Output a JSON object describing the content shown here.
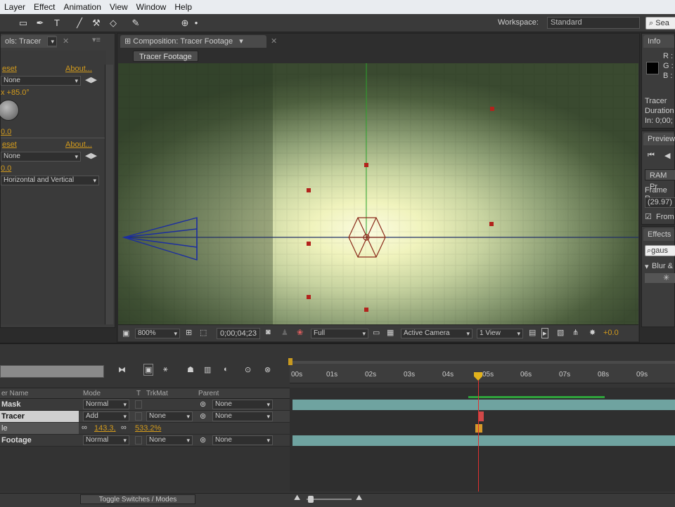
{
  "menu": [
    "Layer",
    "Effect",
    "Animation",
    "View",
    "Window",
    "Help"
  ],
  "workspace": {
    "label": "Workspace:",
    "value": "Standard"
  },
  "search": {
    "placeholder": "Sea"
  },
  "tools_panel": {
    "tab": "ols: Tracer",
    "reset1": "eset",
    "about1": "About...",
    "dd1": "None",
    "angle": "x +85.0°",
    "val1": "0.0",
    "reset2": "eset",
    "about2": "About...",
    "dd2": "None",
    "val2": "0.0",
    "dd3": "Horizontal and Vertical"
  },
  "composition": {
    "tab": "Composition: Tracer Footage",
    "subtab": "Tracer Footage"
  },
  "viewer_bar": {
    "zoom": "800%",
    "timecode": "0;00;04;23",
    "resolution": "Full",
    "camera": "Active Camera",
    "views": "1 View",
    "exposure": "+0.0"
  },
  "info_panel": {
    "tab": "Info",
    "r": "R :",
    "g": "G :",
    "b": "B :",
    "name": "Tracer",
    "duration": "Duration",
    "in": "In: 0;00;"
  },
  "preview_panel": {
    "tab": "Preview",
    "ram": "RAM Pr",
    "frame_rate": "Frame R",
    "fps": "(29.97)",
    "from": "From"
  },
  "effects_panel": {
    "tab": "Effects",
    "search": "gaus",
    "blur": "Blur &"
  },
  "timeline": {
    "headers": {
      "name": "er Name",
      "mode": "Mode",
      "t": "T",
      "trkmat": "TrkMat",
      "parent": "Parent"
    },
    "ruler": [
      "00s",
      "01s",
      "02s",
      "03s",
      "04s",
      "05s",
      "06s",
      "07s",
      "08s",
      "09s"
    ],
    "layers": [
      {
        "name": "Mask",
        "mode": "Normal",
        "trkmat": "",
        "parent": "None"
      },
      {
        "name": "Tracer",
        "mode": "Add",
        "trkmat": "None",
        "parent": "None"
      },
      {
        "name": "le",
        "mode": "",
        "trkmat": "",
        "parent": ""
      },
      {
        "name": "Footage",
        "mode": "Normal",
        "trkmat": "None",
        "parent": "None"
      }
    ],
    "scale_vals": {
      "a": "143.3,",
      "b": "533.2%"
    },
    "toggle": "Toggle Switches / Modes"
  }
}
